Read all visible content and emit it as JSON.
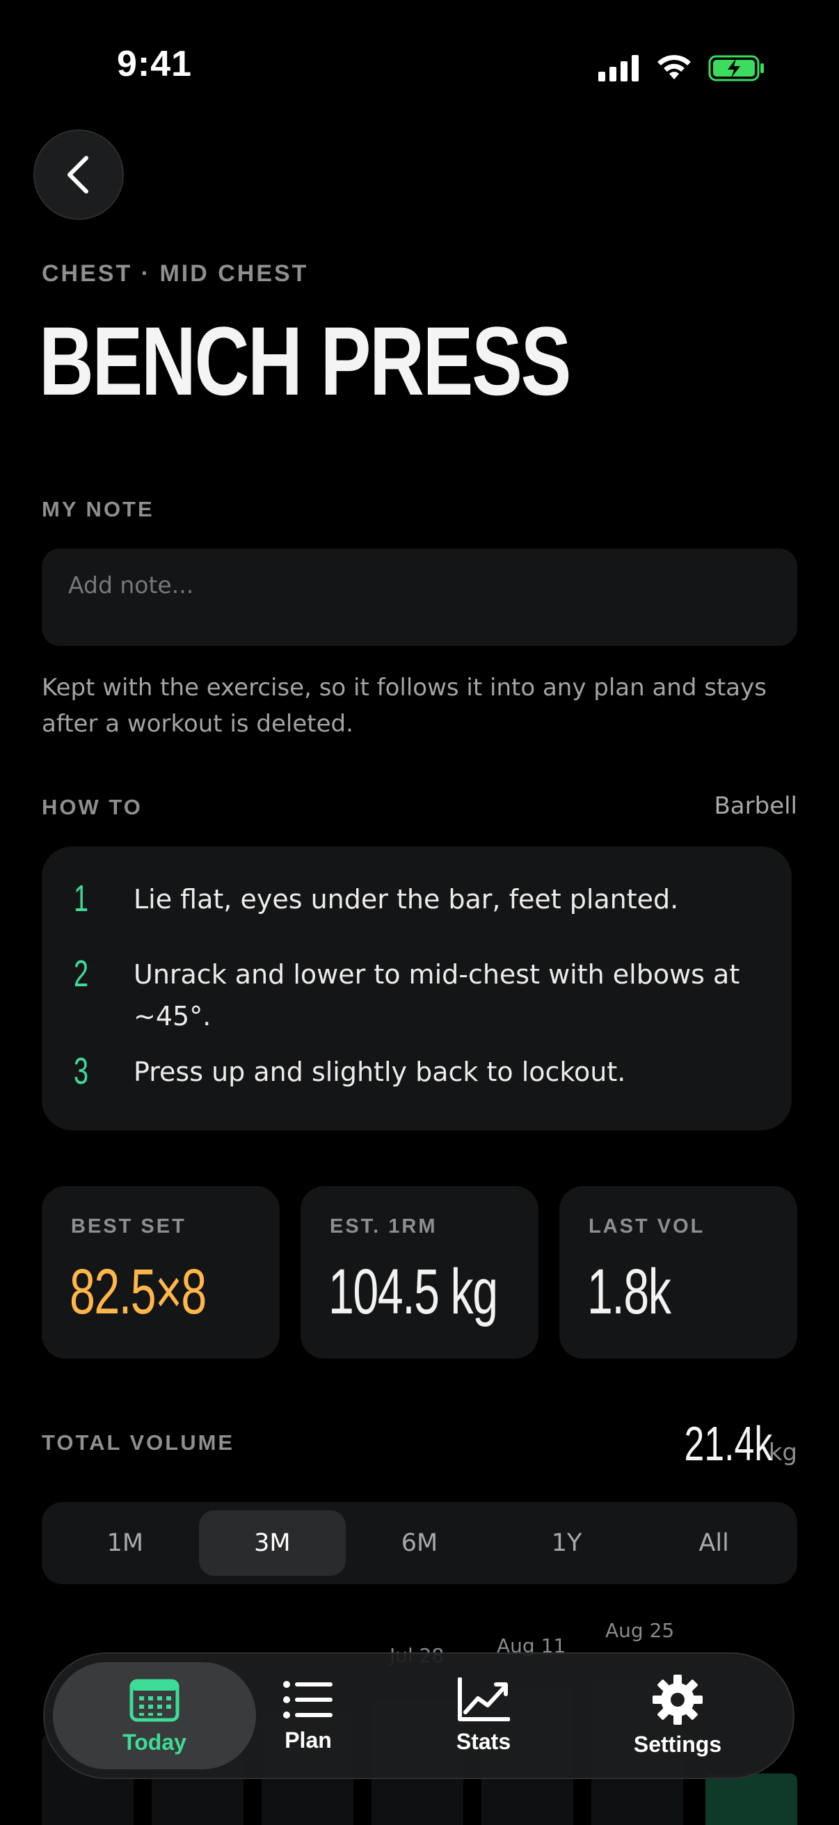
{
  "status_bar": {
    "time": "9:41"
  },
  "header": {
    "eyebrow": "CHEST · MID CHEST",
    "title": "BENCH PRESS"
  },
  "note": {
    "label": "MY NOTE",
    "placeholder": "Add note...",
    "value": "",
    "help": "Kept with the exercise, so it follows it into any plan and stays after a workout is deleted."
  },
  "howto": {
    "label": "HOW TO",
    "equipment": "Barbell",
    "steps": [
      {
        "num": "1",
        "text": "Lie flat, eyes under the bar, feet planted."
      },
      {
        "num": "2",
        "text": "Unrack and lower to mid-chest with elbows at ~45°."
      },
      {
        "num": "3",
        "text": "Press up and slightly back to lockout."
      }
    ]
  },
  "stats": [
    {
      "label": "BEST SET",
      "value": "82.5×8"
    },
    {
      "label": "EST. 1RM",
      "value": "104.5 kg"
    },
    {
      "label": "LAST VOL",
      "value": "1.8k"
    }
  ],
  "total_volume": {
    "label": "TOTAL VOLUME",
    "value": "21.4k",
    "unit": "kg"
  },
  "range_tabs": {
    "items": [
      "1M",
      "3M",
      "6M",
      "1Y",
      "All"
    ],
    "selected": "3M"
  },
  "chart": {
    "dates": [
      "Jul 28",
      "Aug 11",
      "Aug 25"
    ]
  },
  "tabbar": {
    "items": [
      {
        "label": "Today",
        "icon": "calendar-icon"
      },
      {
        "label": "Plan",
        "icon": "list-icon"
      },
      {
        "label": "Stats",
        "icon": "chart-icon"
      },
      {
        "label": "Settings",
        "icon": "gear-icon"
      }
    ],
    "active": "Today"
  },
  "colors": {
    "background": "#000000",
    "card": "#141516",
    "accent_green": "#3ddc97",
    "accent_orange": "#ffb64a",
    "muted": "#8e8f91"
  }
}
